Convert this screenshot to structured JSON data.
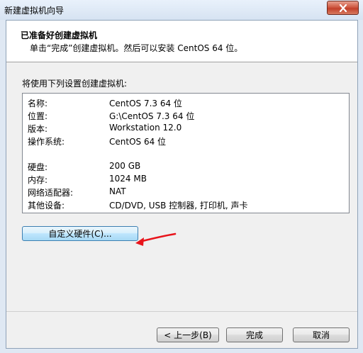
{
  "window": {
    "title": "新建虚拟机向导"
  },
  "header": {
    "title": "已准备好创建虚拟机",
    "subtitle": "单击“完成”创建虚拟机。然后可以安装 CentOS 64 位。"
  },
  "intro_label": "将使用下列设置创建虚拟机:",
  "settings": [
    {
      "key": "名称:",
      "value": "CentOS 7.3 64 位"
    },
    {
      "key": "位置:",
      "value": "G:\\CentOS 7.3 64 位"
    },
    {
      "key": "版本:",
      "value": "Workstation 12.0"
    },
    {
      "key": "操作系统:",
      "value": "CentOS 64 位"
    },
    {
      "key": "硬盘:",
      "value": "200 GB"
    },
    {
      "key": "内存:",
      "value": "1024 MB"
    },
    {
      "key": "网络适配器:",
      "value": "NAT"
    },
    {
      "key": "其他设备:",
      "value": "CD/DVD, USB 控制器, 打印机, 声卡"
    }
  ],
  "buttons": {
    "customize": "自定义硬件(C)...",
    "back": "< 上一步(B)",
    "finish": "完成",
    "cancel": "取消"
  },
  "colors": {
    "annotation_arrow": "#e8141b",
    "close_button": "#c2402a"
  },
  "icons": {
    "close": "close-icon",
    "annotation": "arrow-annotation"
  }
}
